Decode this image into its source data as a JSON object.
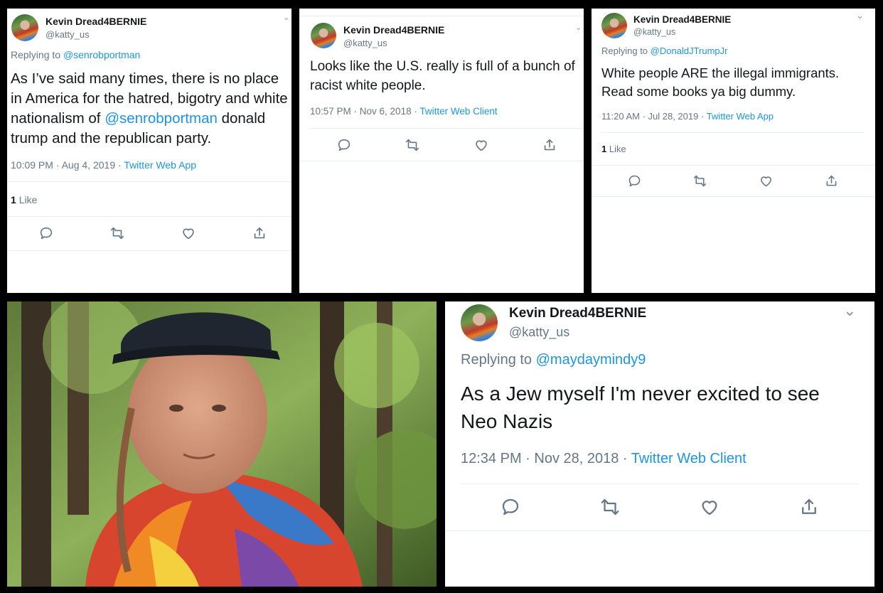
{
  "tweet1": {
    "name": "Kevin Dread4BERNIE",
    "handle": "@katty_us",
    "replying_label": "Replying to",
    "replying_to": "@senrobportman",
    "text_a": "As I’ve said many times, there is no place in America for the hatred, bigotry and white nationalism of",
    "text_mention": "@senrobportman",
    "text_b": "donald trump and the republican party.",
    "time": "10:09 PM · Aug 4, 2019 ·",
    "client": "Twitter Web App",
    "likes_count": "1",
    "likes_label": "Like"
  },
  "tweet2": {
    "name": "Kevin Dread4BERNIE",
    "handle": "@katty_us",
    "text": "Looks like the U.S. really is full of a bunch of racist white people.",
    "time": "10:57 PM · Nov 6, 2018 ·",
    "client": "Twitter Web Client"
  },
  "tweet3": {
    "name": "Kevin Dread4BERNIE",
    "handle": "@katty_us",
    "replying_label": "Replying to",
    "replying_to": "@DonaldJTrumpJr",
    "text": "White people ARE the illegal immigrants. Read some books ya big dummy.",
    "time": "11:20 AM · Jul 28, 2019 ·",
    "client": "Twitter Web App",
    "likes_count": "1",
    "likes_label": "Like"
  },
  "tweet4": {
    "name": "Kevin Dread4BERNIE",
    "handle": "@katty_us",
    "replying_label": "Replying to",
    "replying_to": "@maydaymindy9",
    "text": "As a Jew myself I'm never excited to see Neo Nazis",
    "time": "12:34 PM · Nov 28, 2018 ·",
    "client": "Twitter Web Client"
  },
  "icons": {
    "caret": "chevron-down-icon",
    "reply": "reply-icon",
    "retweet": "retweet-icon",
    "like": "heart-icon",
    "share": "share-icon"
  },
  "colors": {
    "link": "#1b95e0",
    "text": "#14171a",
    "secondary": "#657786",
    "background": "#000000"
  }
}
